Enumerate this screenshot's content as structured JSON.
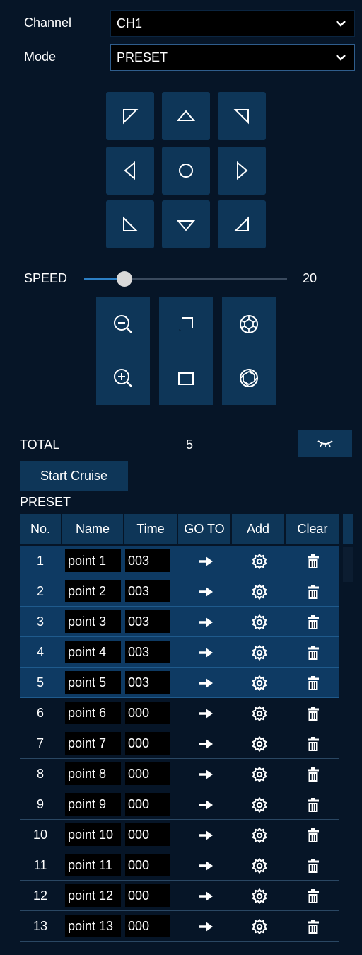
{
  "channel": {
    "label": "Channel",
    "value": "CH1"
  },
  "mode": {
    "label": "Mode",
    "value": "PRESET"
  },
  "speed": {
    "label": "SPEED",
    "value": "20",
    "fraction": 0.2
  },
  "total": {
    "label": "TOTAL",
    "value": "5"
  },
  "cruise_button": "Start Cruise",
  "preset_label": "PRESET",
  "columns": [
    "No.",
    "Name",
    "Time",
    "GO TO",
    "Add",
    "Clear"
  ],
  "rows": [
    {
      "no": "1",
      "name": "point 1",
      "time": "003",
      "highlighted": true
    },
    {
      "no": "2",
      "name": "point 2",
      "time": "003",
      "highlighted": true
    },
    {
      "no": "3",
      "name": "point 3",
      "time": "003",
      "highlighted": true
    },
    {
      "no": "4",
      "name": "point 4",
      "time": "003",
      "highlighted": true
    },
    {
      "no": "5",
      "name": "point 5",
      "time": "003",
      "highlighted": true
    },
    {
      "no": "6",
      "name": "point 6",
      "time": "000",
      "highlighted": false
    },
    {
      "no": "7",
      "name": "point 7",
      "time": "000",
      "highlighted": false
    },
    {
      "no": "8",
      "name": "point 8",
      "time": "000",
      "highlighted": false
    },
    {
      "no": "9",
      "name": "point 9",
      "time": "000",
      "highlighted": false
    },
    {
      "no": "10",
      "name": "point 10",
      "time": "000",
      "highlighted": false
    },
    {
      "no": "11",
      "name": "point 11",
      "time": "000",
      "highlighted": false
    },
    {
      "no": "12",
      "name": "point 12",
      "time": "000",
      "highlighted": false
    },
    {
      "no": "13",
      "name": "point 13",
      "time": "000",
      "highlighted": false
    }
  ],
  "icons": {
    "ptz": [
      "up-left-icon",
      "up-icon",
      "up-right-icon",
      "left-icon",
      "center-icon",
      "right-icon",
      "down-left-icon",
      "down-icon",
      "down-right-icon"
    ],
    "zoom": [
      "zoom-out-icon",
      "focus-near-icon",
      "iris-close-icon",
      "zoom-in-icon",
      "focus-far-icon",
      "iris-open-icon"
    ],
    "row": [
      "arrow-right-icon",
      "gear-icon",
      "trash-icon"
    ]
  },
  "colors": {
    "background": "#061527",
    "button": "#0e3658",
    "highlight_row": "#0e3a63",
    "slider_fill": "#2c7fc4"
  }
}
